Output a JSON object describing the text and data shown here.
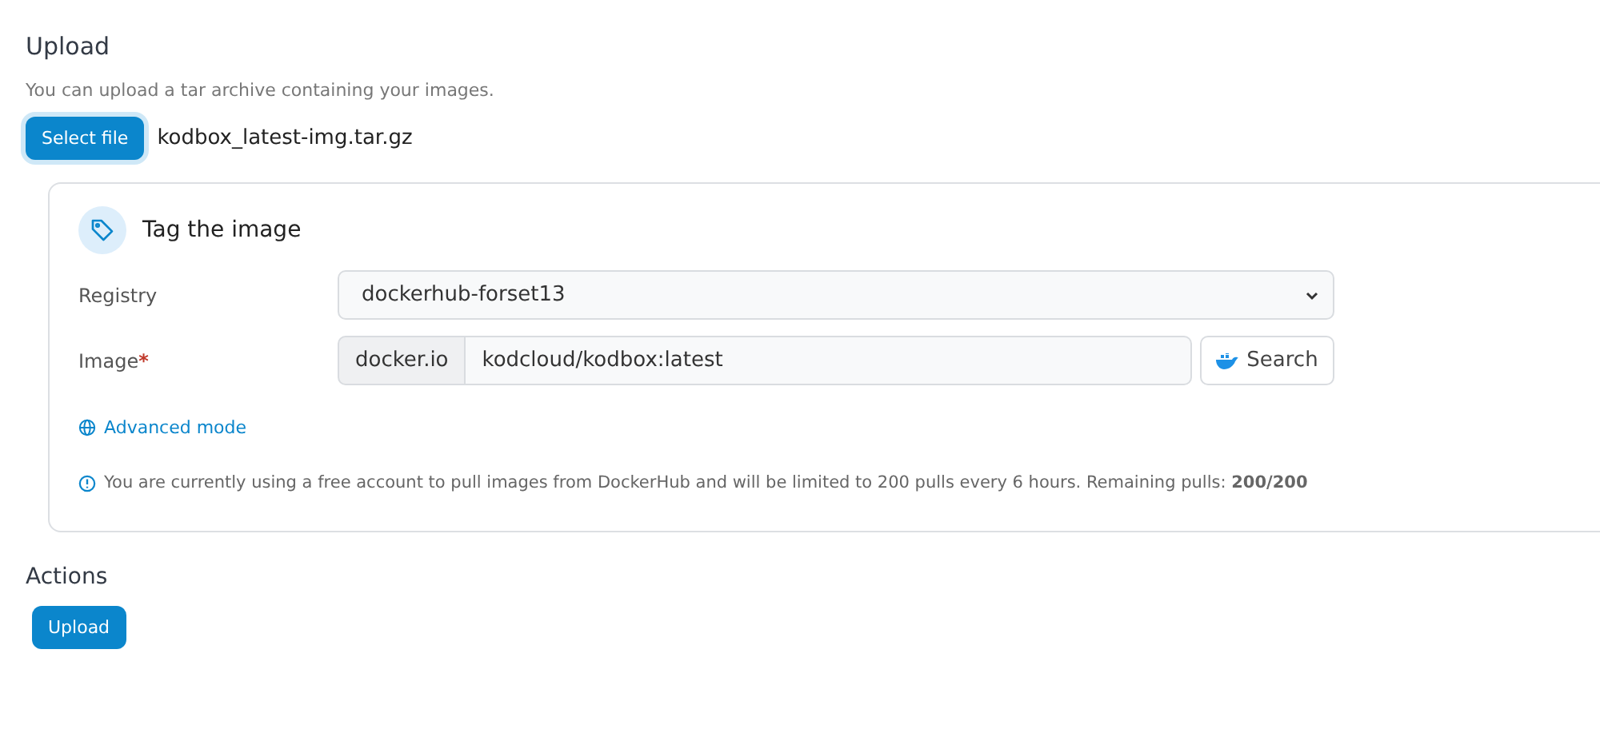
{
  "upload": {
    "title": "Upload",
    "description": "You can upload a tar archive containing your images.",
    "select_button": "Select file",
    "file_name": "kodbox_latest-img.tar.gz"
  },
  "tag_card": {
    "title": "Tag the image",
    "registry": {
      "label": "Registry",
      "value": "dockerhub-forset13"
    },
    "image": {
      "label": "Image",
      "required_mark": "*",
      "prefix": "docker.io",
      "value": "kodcloud/kodbox:latest",
      "search_button": "Search"
    },
    "advanced_link": "Advanced mode",
    "notice": "You are currently using a free account to pull images from DockerHub and will be limited to 200 pulls every 6 hours. Remaining pulls: **200/200**"
  },
  "actions": {
    "title": "Actions",
    "upload_button": "Upload"
  }
}
